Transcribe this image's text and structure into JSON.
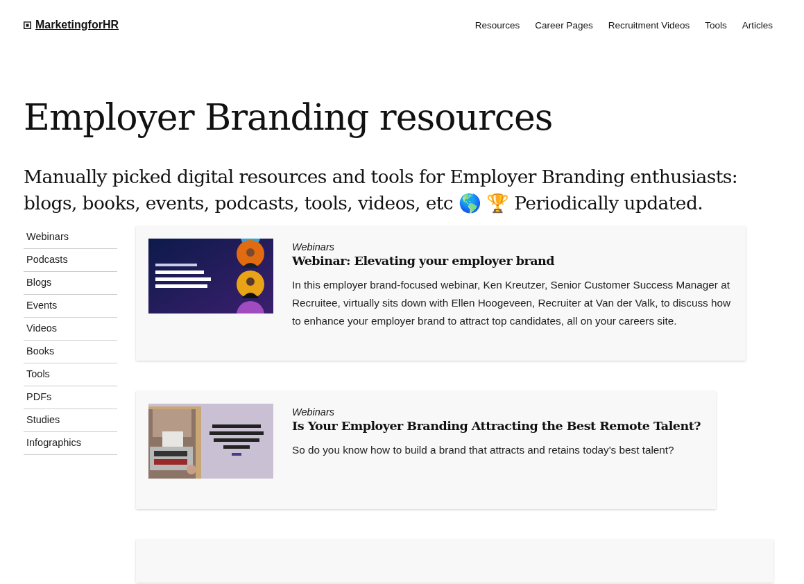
{
  "header": {
    "logo": "MarketingforHR",
    "nav": [
      "Resources",
      "Career Pages",
      "Recruitment Videos",
      "Tools",
      "Articles"
    ]
  },
  "title": "Employer Branding resources",
  "subtitle": "Manually picked digital resources and tools for Employer Branding enthusiasts: blogs, books, events, podcasts, tools, videos, etc 🌎 🏆 Periodically updated.",
  "sidebar": {
    "items": [
      "Webinars",
      "Podcasts",
      "Blogs",
      "Events",
      "Videos",
      "Books",
      "Tools",
      "PDFs",
      "Studies",
      "Infographics"
    ]
  },
  "cards": [
    {
      "kind": "full",
      "category": "Webinars",
      "title": "Webinar: Elevating your employer brand",
      "description": "In this employer brand-focused webinar, Ken Kreutzer, Senior Customer Success Manager at Recruitee, virtually sits down with Ellen Hoogeveen, Recruiter at Van der Valk, to discuss how to enhance your employer brand to attract top candidates, all on your careers site."
    },
    {
      "kind": "full",
      "category": "Webinars",
      "title": "Is Your Employer Branding Attracting the Best Remote Talent?",
      "description": "So do you know how to build a brand that attracts and retains today's best talent?"
    },
    {
      "kind": "clipped"
    }
  ]
}
